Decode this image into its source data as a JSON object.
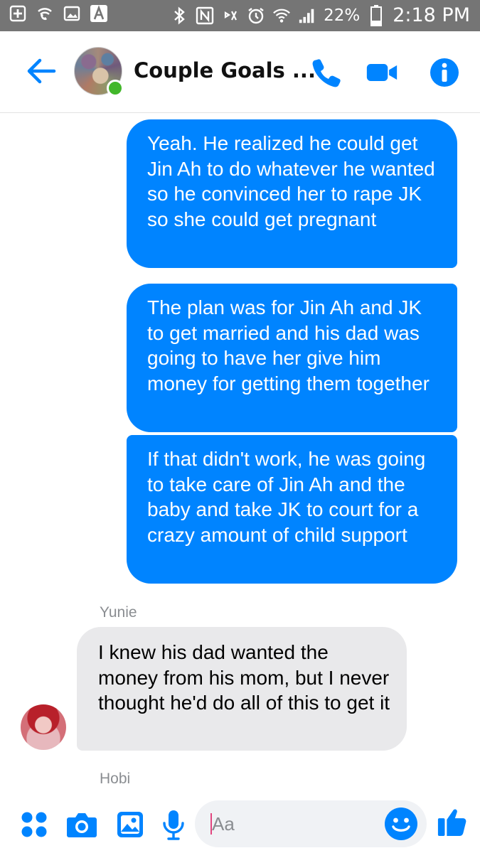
{
  "status_bar": {
    "battery": "22%",
    "time": "2:18 PM",
    "icons": [
      "plus-icon",
      "wifi-call-icon",
      "image-icon",
      "font-icon",
      "bluetooth-icon",
      "nfc-icon",
      "mute-icon",
      "alarm-icon",
      "wifi-icon",
      "signal-icon",
      "battery-icon"
    ]
  },
  "header": {
    "title": "Couple Goals ...",
    "online": true,
    "accent_color": "#0084ff",
    "icons": [
      "back-arrow-icon",
      "phone-icon",
      "video-camera-icon",
      "info-icon"
    ]
  },
  "messages": {
    "outgoing": [
      "Yeah. He realized he could get Jin Ah to do whatever he wanted so he convinced her to rape JK so she could get pregnant",
      "The plan was for Jin Ah and JK to get married and his dad was going to have her give him money for getting them together",
      "If that didn't work, he was going to take care of Jin Ah and the baby and take JK to court for a crazy amount of child support"
    ],
    "incoming": {
      "sender": "Yunie",
      "text": "I knew his dad wanted the money from his mom, but I never thought he'd do all of this to get it"
    },
    "next_sender": "Hobi"
  },
  "composer": {
    "placeholder": "Aa",
    "icons": [
      "apps-icon",
      "camera-icon",
      "gallery-icon",
      "microphone-icon",
      "emoji-icon",
      "thumbs-up-icon"
    ]
  }
}
